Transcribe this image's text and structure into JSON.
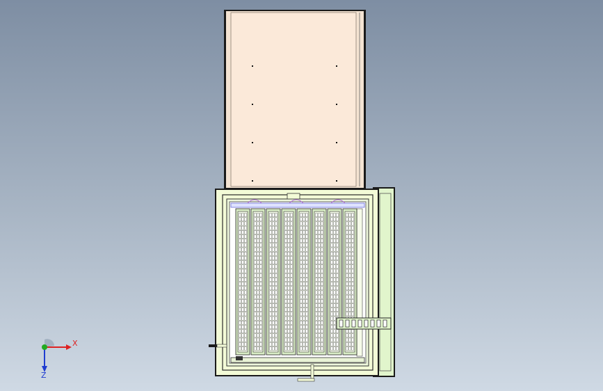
{
  "view": {
    "background_top": "#7e8ea3",
    "background_bottom": "#cfd9e4"
  },
  "model": {
    "lid_color": "#fbe9d9",
    "cabinet_color": "#f3fbd7",
    "side_panel_color": "#e1f5cc",
    "tray_color": "#d8ecc4",
    "outline_color": "#1a1a1a",
    "tray_columns": 8
  },
  "triad": {
    "x_label": "X",
    "z_label": "Z",
    "x_color": "#dd2222",
    "y_color": "#22aa22",
    "z_color": "#1f3cd0"
  }
}
